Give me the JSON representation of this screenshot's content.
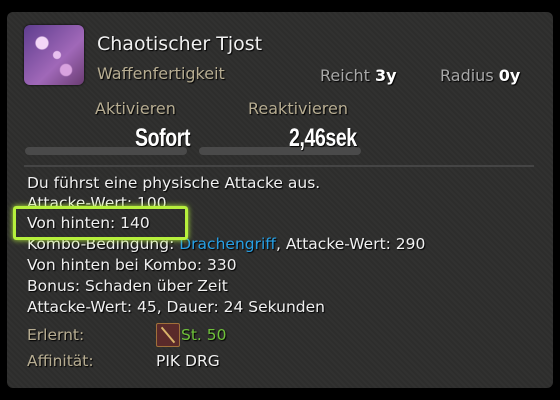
{
  "action": {
    "name": "Chaotischer Tjost",
    "type": "Waffenfertigkeit",
    "range_label": "Reicht",
    "range_value": "3y",
    "radius_label": "Radius",
    "radius_value": "0y",
    "cast_label": "Aktivieren",
    "cast_value": "Sofort",
    "recast_label": "Reaktivieren",
    "recast_value": "2,46sek"
  },
  "description": {
    "line1": "Du führst eine physische Attacke aus.",
    "line2": "Attacke-Wert: 100",
    "line3": "Von hinten: 140",
    "line4_prefix": "Kombo-Bedingung: ",
    "line4_link": "Drachengriff",
    "line4_suffix": ", Attacke-Wert: 290",
    "line5": "Von hinten bei Kombo: 330",
    "line6": "Bonus: Schaden über Zeit",
    "line7": "Attacke-Wert: 45, Dauer: 24 Sekunden"
  },
  "footer": {
    "learned_label": "Erlernt:",
    "learned_value": "St. 50",
    "learned_icon": "spear-icon",
    "affinity_label": "Affinität:",
    "affinity_value": "PIK DRG"
  },
  "colors": {
    "highlight": "#b6f03c",
    "link": "#27a0e6",
    "level": "#6fc23a",
    "label": "#b7ad92"
  }
}
